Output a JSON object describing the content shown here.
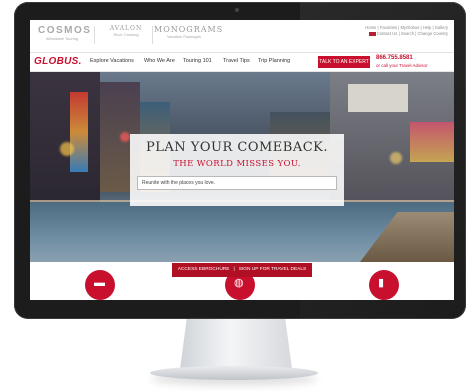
{
  "brands": {
    "cosmos": {
      "name": "COSMOS",
      "tagline": "Affordable Touring"
    },
    "avalon": {
      "name": "AVALON",
      "tagline": "River Cruising"
    },
    "monograms": {
      "name": "MONOGRAMS",
      "tagline": "Vacation Packages"
    }
  },
  "utility": {
    "line1": "Home | Favorites | MyGlobus | Help | Gallery",
    "line2": "Contact Us | Search | Change Country"
  },
  "nav": {
    "logo": "GLOBUS.",
    "items": [
      "Explore Vacations",
      "Who We Are",
      "Touring 101",
      "Travel Tips",
      "Trip Planning"
    ],
    "cta": "TALK TO AN EXPERT",
    "phone": "866.755.8581",
    "phone_sub": "or call your Travel Advisor"
  },
  "hero": {
    "title": "PLAN YOUR COMEBACK.",
    "subtitle": "THE WORLD MISSES YOU.",
    "search_value": "Reunite with the places you love."
  },
  "lower": {
    "ebrochure": "ACCESS EBROCHURE",
    "signup": "SIGN UP FOR TRAVEL DEALS"
  },
  "colors": {
    "brand_red": "#c8102e",
    "bezel": "#1c1c1c"
  },
  "icons": [
    "brochure-icon",
    "globe-icon",
    "chart-icon",
    "flag-icon",
    "search-icon"
  ]
}
